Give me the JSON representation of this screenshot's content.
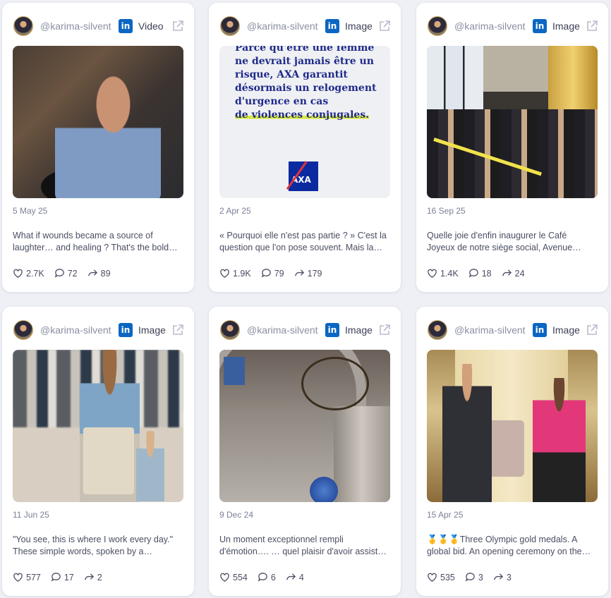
{
  "posts": [
    {
      "handle": "@karima-silvent",
      "network_icon": "linkedin-icon",
      "type": "Video",
      "date": "5 May 25",
      "caption_line1": "What if wounds became a source of",
      "caption_line2": "laughter… and healing ? That's the bold…",
      "likes": "2.7K",
      "comments": "72",
      "shares": "89"
    },
    {
      "handle": "@karima-silvent",
      "network_icon": "linkedin-icon",
      "type": "Image",
      "date": "2 Apr 25",
      "caption_line1": "« Pourquoi elle n'est pas partie ? » C'est la",
      "caption_line2": "question que l'on pose souvent.  Mais la…",
      "likes": "1.9K",
      "comments": "79",
      "shares": "179",
      "image_text_1": "Parce qu'être une femme ne devrait jamais être un risque, AXA garantit désormais un relogement d'urgence en cas",
      "image_text_2": "de violences conjugales.",
      "image_logo": "AXA"
    },
    {
      "handle": "@karima-silvent",
      "network_icon": "linkedin-icon",
      "type": "Image",
      "date": "16 Sep 25",
      "caption_line1": "Quelle joie d'enfin inaugurer le Café",
      "caption_line2": "Joyeux de notre siège social, Avenue…",
      "likes": "1.4K",
      "comments": "18",
      "shares": "24"
    },
    {
      "handle": "@karima-silvent",
      "network_icon": "linkedin-icon",
      "type": "Image",
      "date": "11 Jun 25",
      "caption_line1": "\"You see, this is where I work every day.\"",
      "caption_line2": "These simple words, spoken by a…",
      "likes": "577",
      "comments": "17",
      "shares": "2"
    },
    {
      "handle": "@karima-silvent",
      "network_icon": "linkedin-icon",
      "type": "Image",
      "date": "9 Dec 24",
      "caption_line1": "Un moment exceptionnel rempli",
      "caption_line2": "d'émotion…. … quel plaisir d'avoir assisté,…",
      "likes": "554",
      "comments": "6",
      "shares": "4"
    },
    {
      "handle": "@karima-silvent",
      "network_icon": "linkedin-icon",
      "type": "Image",
      "date": "15 Apr 25",
      "caption_line1": "🥇🥇🥇Three Olympic gold medals. A",
      "caption_line2": "global bid. An opening ceremony on the…",
      "likes": "535",
      "comments": "3",
      "shares": "3"
    }
  ],
  "colors": {
    "background": "#eef0f6",
    "card": "#ffffff",
    "linkedin": "#0a66c2",
    "muted_text": "#8b8fa3"
  }
}
